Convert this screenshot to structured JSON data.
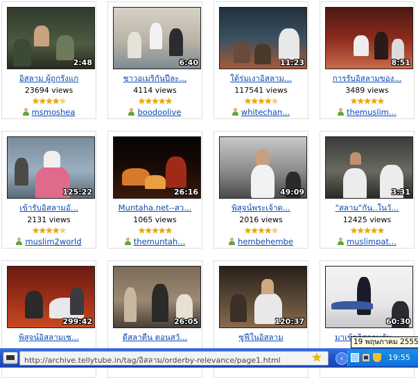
{
  "videos": [
    {
      "title": "อิสลาม ผู้ถูกรังแก",
      "views": "23694 views",
      "user": "msmoshea",
      "duration": "2:48",
      "rating": "4.5"
    },
    {
      "title": "ชาวอเมริกันปีละ...",
      "views": "4114 views",
      "user": "boodoolive",
      "duration": "6:40",
      "rating": "5"
    },
    {
      "title": "ใต้ร่มเงาอิสลาม...",
      "views": "117541 views",
      "user": "whitechan...",
      "duration": "11:23",
      "rating": "4.5"
    },
    {
      "title": "การรับอิสลามของ...",
      "views": "3489 views",
      "user": "themuslim...",
      "duration": "8:51",
      "rating": "5"
    },
    {
      "title": "เข้ารับอิสลามอั...",
      "views": "2131 views",
      "user": "muslim2world",
      "duration": "125:22",
      "rating": "4.5"
    },
    {
      "title": "Muntaha.net--สว...",
      "views": "1065 views",
      "user": "themuntah...",
      "duration": "26:16",
      "rating": "5"
    },
    {
      "title": "พิสูจน์พระเจ้าด...",
      "views": "2016 views",
      "user": "hembehembe",
      "duration": "49:09",
      "rating": "4.5"
    },
    {
      "title": "\"สลาม\"กัน..ในวั...",
      "views": "12425 views",
      "user": "muslimpat...",
      "duration": "3:31",
      "rating": "5"
    },
    {
      "title": "พิสูจน์อิสลามเช...",
      "views": "",
      "user": "",
      "duration": "299:42",
      "rating": ""
    },
    {
      "title": "ดีสลาตีน ตอนสวั...",
      "views": "",
      "user": "",
      "duration": "26:05",
      "rating": ""
    },
    {
      "title": "ซูฟีในอิสลาม",
      "views": "",
      "user": "",
      "duration": "120:37",
      "rating": ""
    },
    {
      "title": "มาเข้าอิสลามกัน...",
      "views": "",
      "user": "",
      "duration": "60:30",
      "rating": ""
    }
  ],
  "browser": {
    "url": "http://archive.tellytube.in/tag/อิสลาม/orderby-relevance/page1.html"
  },
  "taskbar": {
    "clock": "19:55",
    "tooltip": "19 พฤษภาคม 2555"
  },
  "icons": {
    "user": "user-icon",
    "rating": "star-icon",
    "bookmark": "star-icon",
    "start": "tv-icon"
  },
  "colors": {
    "link": "#0b4ab3",
    "star": "#f0a800",
    "taskbar": "#2153c9"
  }
}
